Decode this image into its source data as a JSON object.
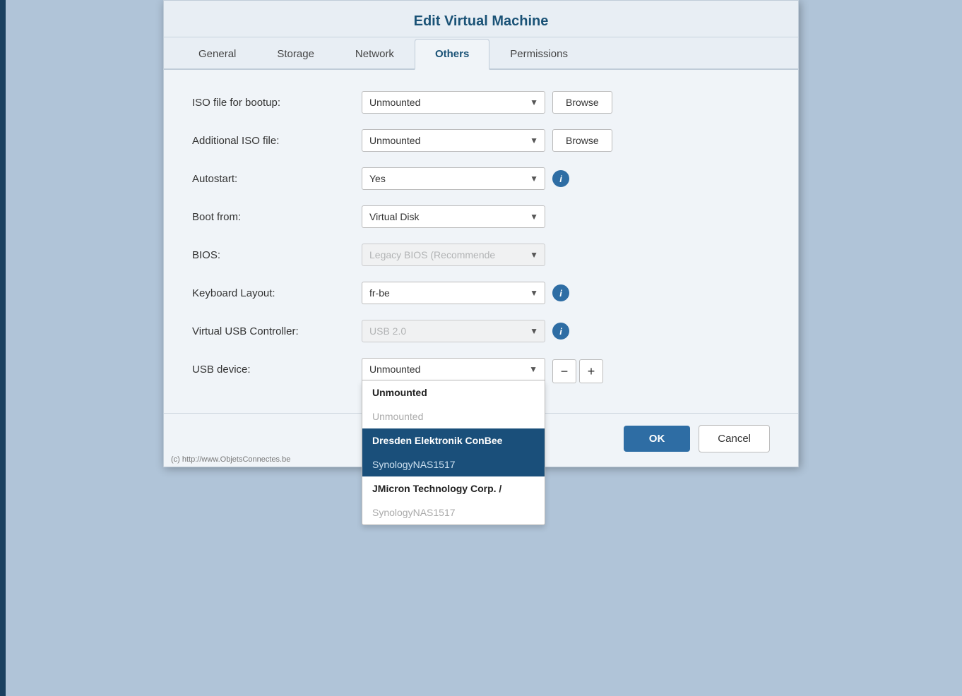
{
  "dialog": {
    "title": "Edit Virtual Machine",
    "tabs": [
      {
        "label": "General",
        "active": false
      },
      {
        "label": "Storage",
        "active": false
      },
      {
        "label": "Network",
        "active": false
      },
      {
        "label": "Others",
        "active": true
      },
      {
        "label": "Permissions",
        "active": false
      }
    ]
  },
  "form": {
    "iso_bootup": {
      "label": "ISO file for bootup:",
      "value": "Unmounted",
      "browse_label": "Browse"
    },
    "additional_iso": {
      "label": "Additional ISO file:",
      "value": "Unmounted",
      "browse_label": "Browse"
    },
    "autostart": {
      "label": "Autostart:",
      "value": "Yes"
    },
    "boot_from": {
      "label": "Boot from:",
      "value": "Virtual Disk"
    },
    "bios": {
      "label": "BIOS:",
      "value": "Legacy BIOS (Recommende"
    },
    "keyboard_layout": {
      "label": "Keyboard Layout:",
      "value": "fr-be"
    },
    "virtual_usb": {
      "label": "Virtual USB Controller:",
      "value": "USB 2.0"
    },
    "usb_device": {
      "label": "USB device:",
      "value": "Unmounted"
    }
  },
  "dropdown": {
    "items": [
      {
        "label": "Unmounted",
        "style": "selected-bold"
      },
      {
        "label": "Unmounted",
        "style": "muted"
      },
      {
        "label": "Dresden Elektronik ConBee",
        "style": "highlighted"
      },
      {
        "label": "SynologyNAS1517",
        "style": "highlighted-sub"
      },
      {
        "label": "JMicron Technology Corp. /",
        "style": "bold-dark"
      },
      {
        "label": "SynologyNAS1517",
        "style": "sub-muted"
      }
    ]
  },
  "footer": {
    "ok_label": "OK",
    "cancel_label": "Cancel"
  },
  "copyright": "(c) http://www.ObjetsConnectes.be"
}
